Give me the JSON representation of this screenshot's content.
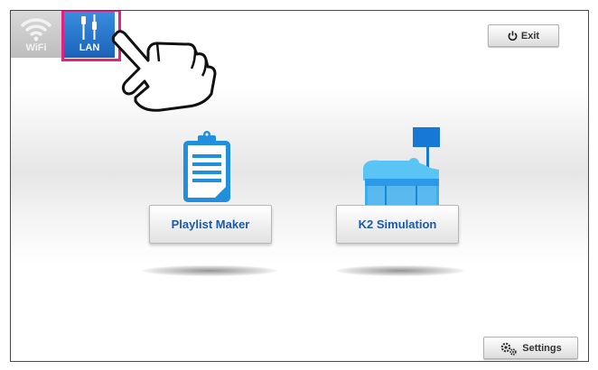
{
  "tabs": {
    "wifi": {
      "label": "WiFi",
      "icon": "wifi-icon"
    },
    "lan": {
      "label": "LAN",
      "icon": "lan-cable-icon"
    }
  },
  "header": {
    "exit_label": "Exit",
    "exit_icon": "power-icon"
  },
  "apps": [
    {
      "label": "Playlist Maker",
      "icon": "clipboard-list-icon"
    },
    {
      "label": "K2 Simulation",
      "icon": "hospital-bed-icon"
    }
  ],
  "footer": {
    "settings_label": "Settings",
    "settings_icon": "gears-icon"
  },
  "annotation": {
    "icon": "pointing-hand-icon",
    "highlight_color": "#e0218a"
  },
  "colors": {
    "accent": "#1b5aa8",
    "lan_tab": "#2a78cc",
    "icon_blue": "#33a7ea"
  }
}
